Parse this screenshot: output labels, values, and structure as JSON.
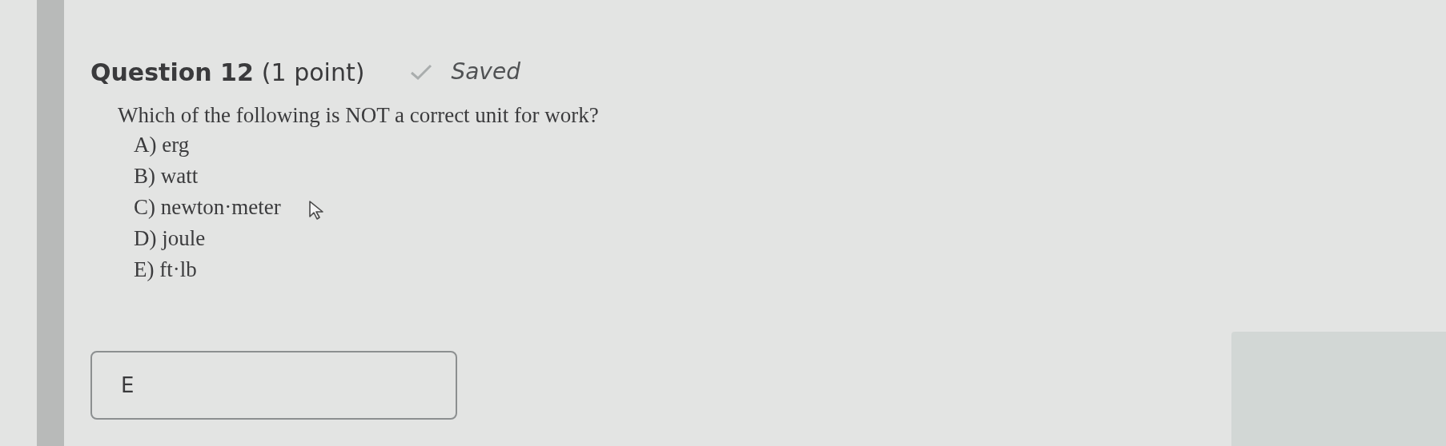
{
  "question": {
    "title": "Question 12",
    "points": "(1 point)",
    "status": "Saved",
    "prompt": "Which of the following is NOT a correct unit for work?",
    "options": [
      "A) erg",
      "B) watt",
      "C) newton·meter",
      "D) joule",
      "E) ft·lb"
    ],
    "answer": {
      "value": "E"
    }
  }
}
